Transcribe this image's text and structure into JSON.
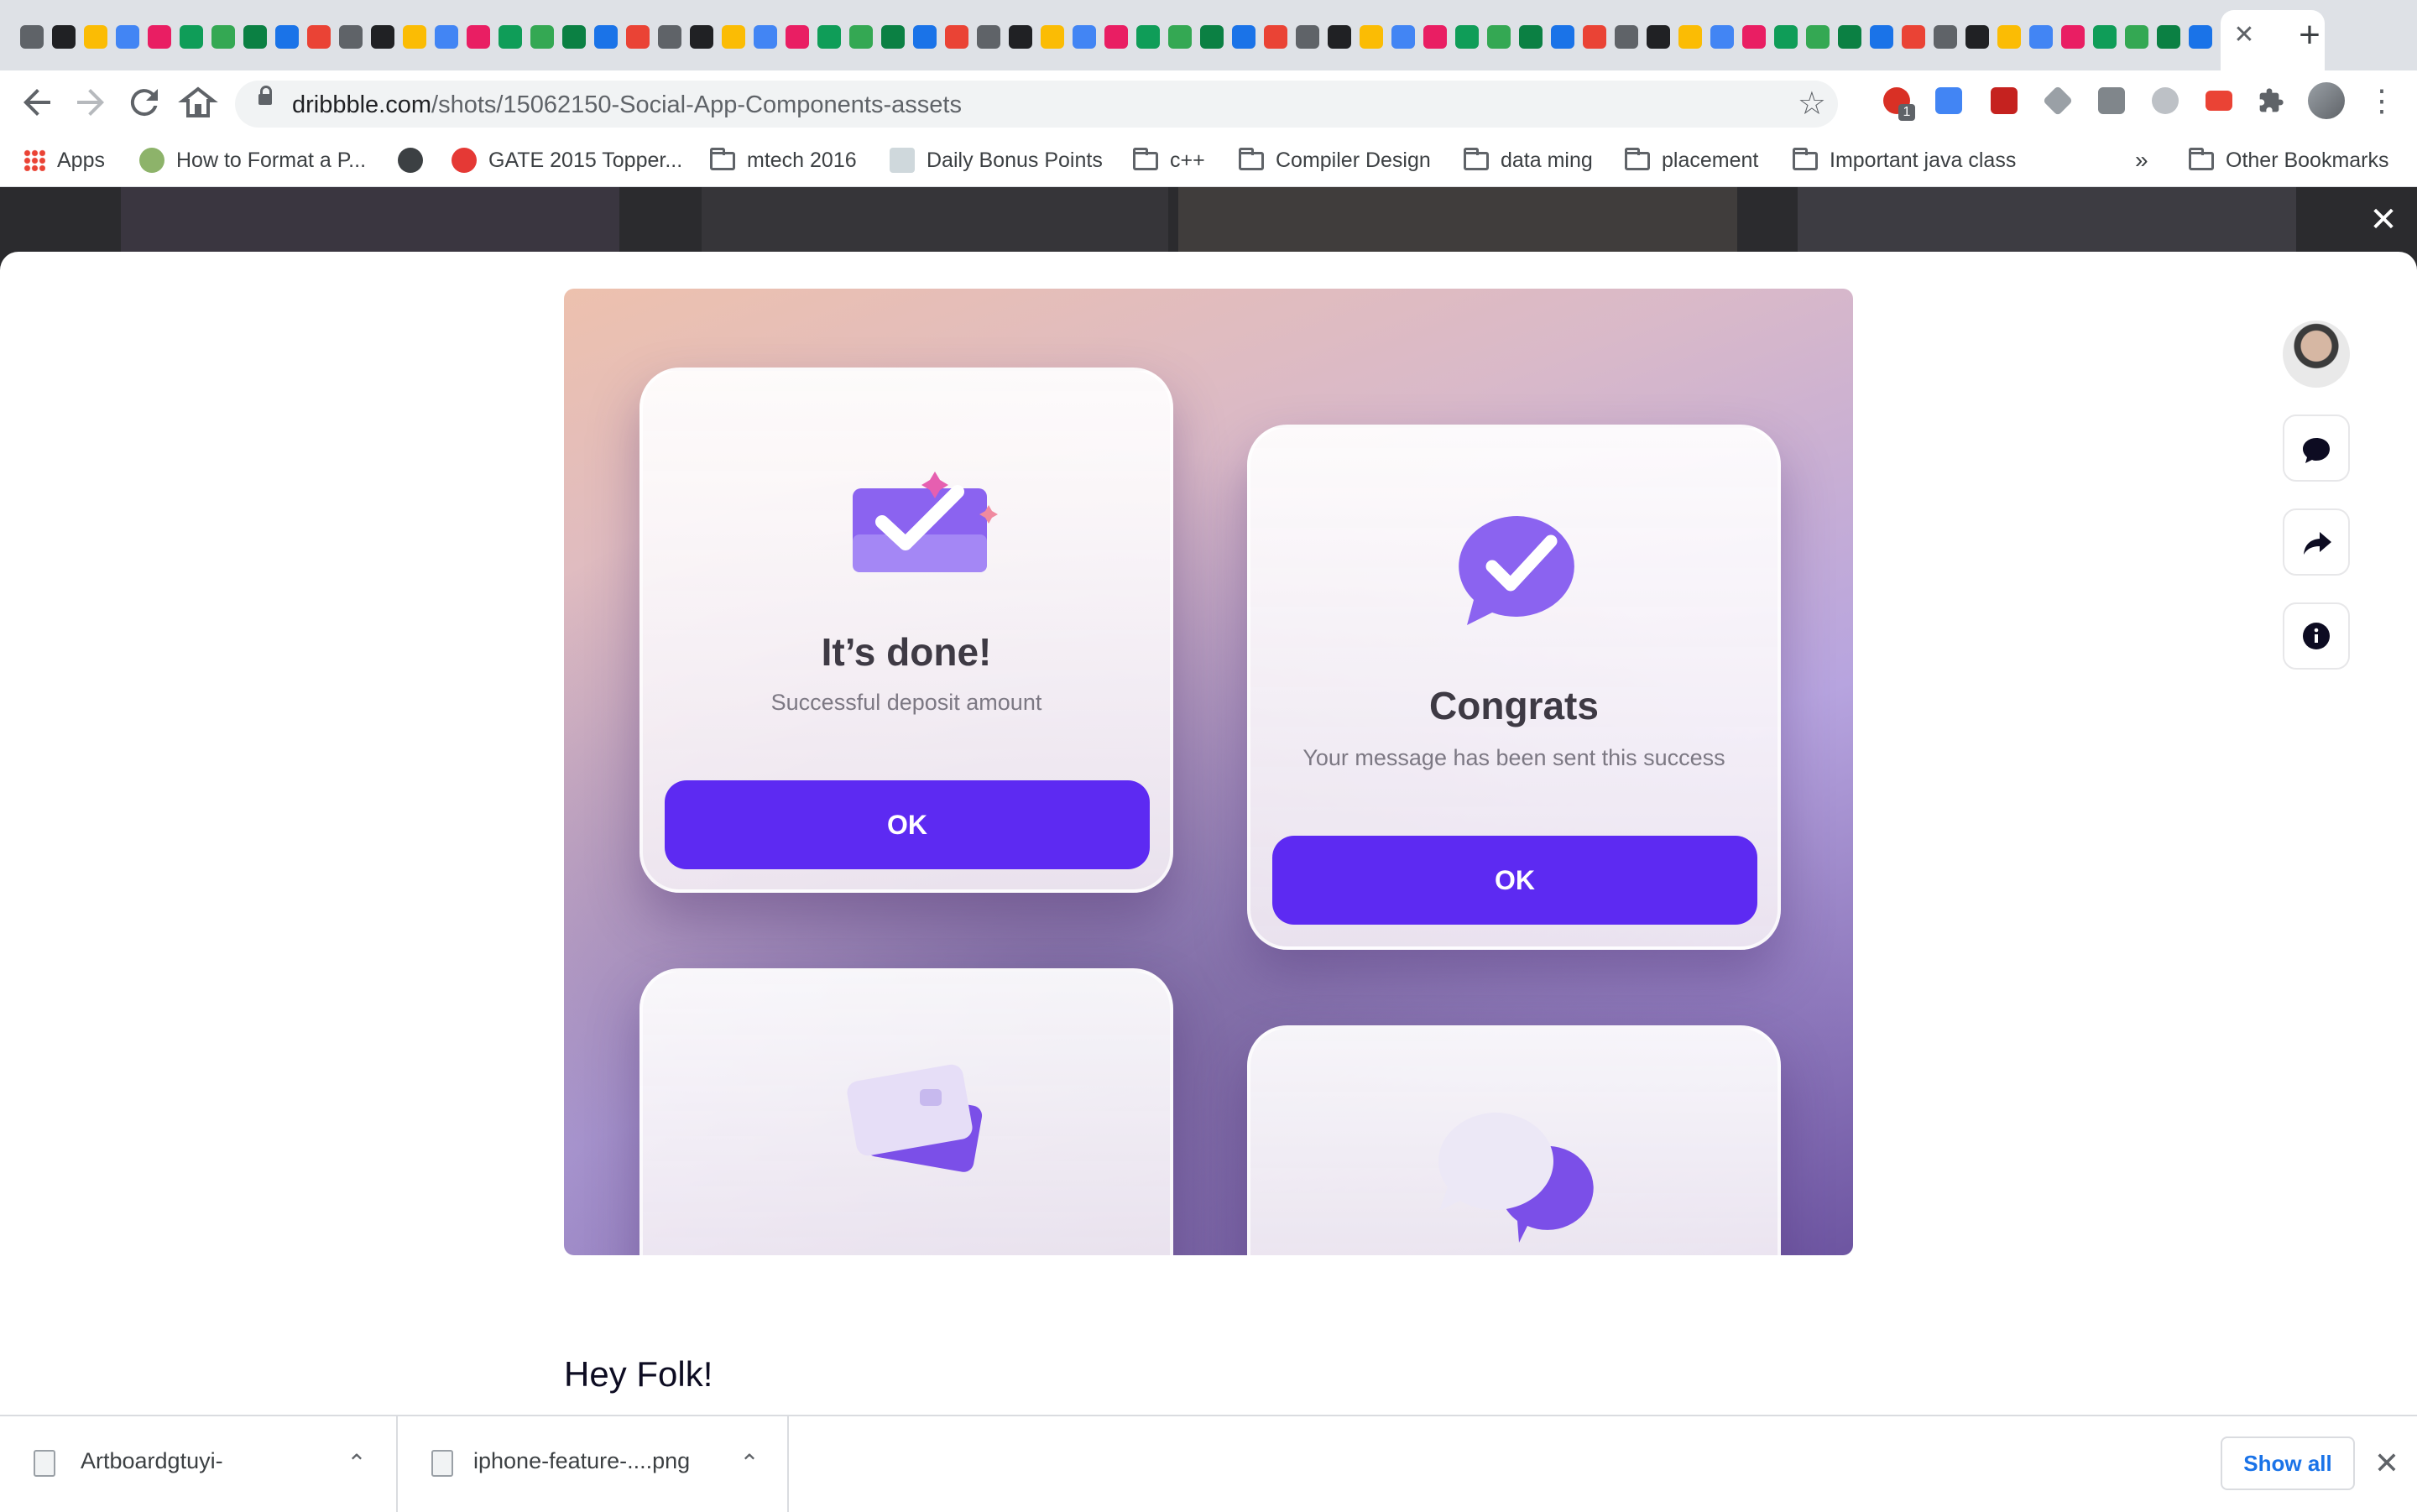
{
  "browser": {
    "address_bar": {
      "domain": "dribbble.com",
      "path": "/shots/15062150-Social-App-Components-assets"
    },
    "tab_close_glyph": "✕",
    "new_tab_glyph": "+",
    "icons": [
      "back-arrow-icon",
      "forward-arrow-icon",
      "reload-icon",
      "home-icon",
      "lock-icon",
      "star-icon",
      "extensions-icon",
      "profile-avatar",
      "more-menu-icon"
    ],
    "extension_badge": "1"
  },
  "bookmarks": {
    "items": [
      {
        "label": "Apps",
        "icon": "apps-grid-icon"
      },
      {
        "label": "How to Format a P...",
        "icon": "site-icon"
      },
      {
        "label": "",
        "icon": "globe-icon"
      },
      {
        "label": "GATE 2015 Topper...",
        "icon": "site-icon"
      },
      {
        "label": "mtech 2016",
        "icon": "folder-icon"
      },
      {
        "label": "Daily Bonus Points",
        "icon": "site-icon"
      },
      {
        "label": "c++",
        "icon": "folder-icon"
      },
      {
        "label": "Compiler Design",
        "icon": "folder-icon"
      },
      {
        "label": "data ming",
        "icon": "folder-icon"
      },
      {
        "label": "placement",
        "icon": "folder-icon"
      },
      {
        "label": "Important java class",
        "icon": "folder-icon"
      }
    ],
    "overflow_label": "»",
    "other_label": "Other Bookmarks"
  },
  "shot": {
    "cards": [
      {
        "title": "It’s done!",
        "subtitle": "Successful deposit amount",
        "button": "OK",
        "icon": "wallet-check-icon"
      },
      {
        "title": "Congrats",
        "subtitle": "Your message has been sent this success",
        "button": "OK",
        "icon": "chat-check-icon"
      },
      {
        "title": "",
        "subtitle": "",
        "button": "",
        "icon": "cards-icon"
      },
      {
        "title": "",
        "subtitle": "",
        "button": "",
        "icon": "chat-bubbles-icon"
      }
    ],
    "colors": {
      "button": "#5d2af2",
      "accent_purple": "#8b63f0"
    }
  },
  "overlay": {
    "close_glyph": "✕"
  },
  "sidebar": {
    "actions": [
      {
        "name": "designer-avatar"
      },
      {
        "name": "comment-icon"
      },
      {
        "name": "share-icon"
      },
      {
        "name": "info-icon"
      }
    ]
  },
  "description": {
    "heading": "Hey Folk!"
  },
  "downloads": {
    "items": [
      {
        "filename": "Artboardgtuyi-"
      },
      {
        "filename": "iphone-feature-....png"
      }
    ],
    "show_all_label": "Show all",
    "close_glyph": "✕",
    "chevron_glyph": "⌃"
  }
}
